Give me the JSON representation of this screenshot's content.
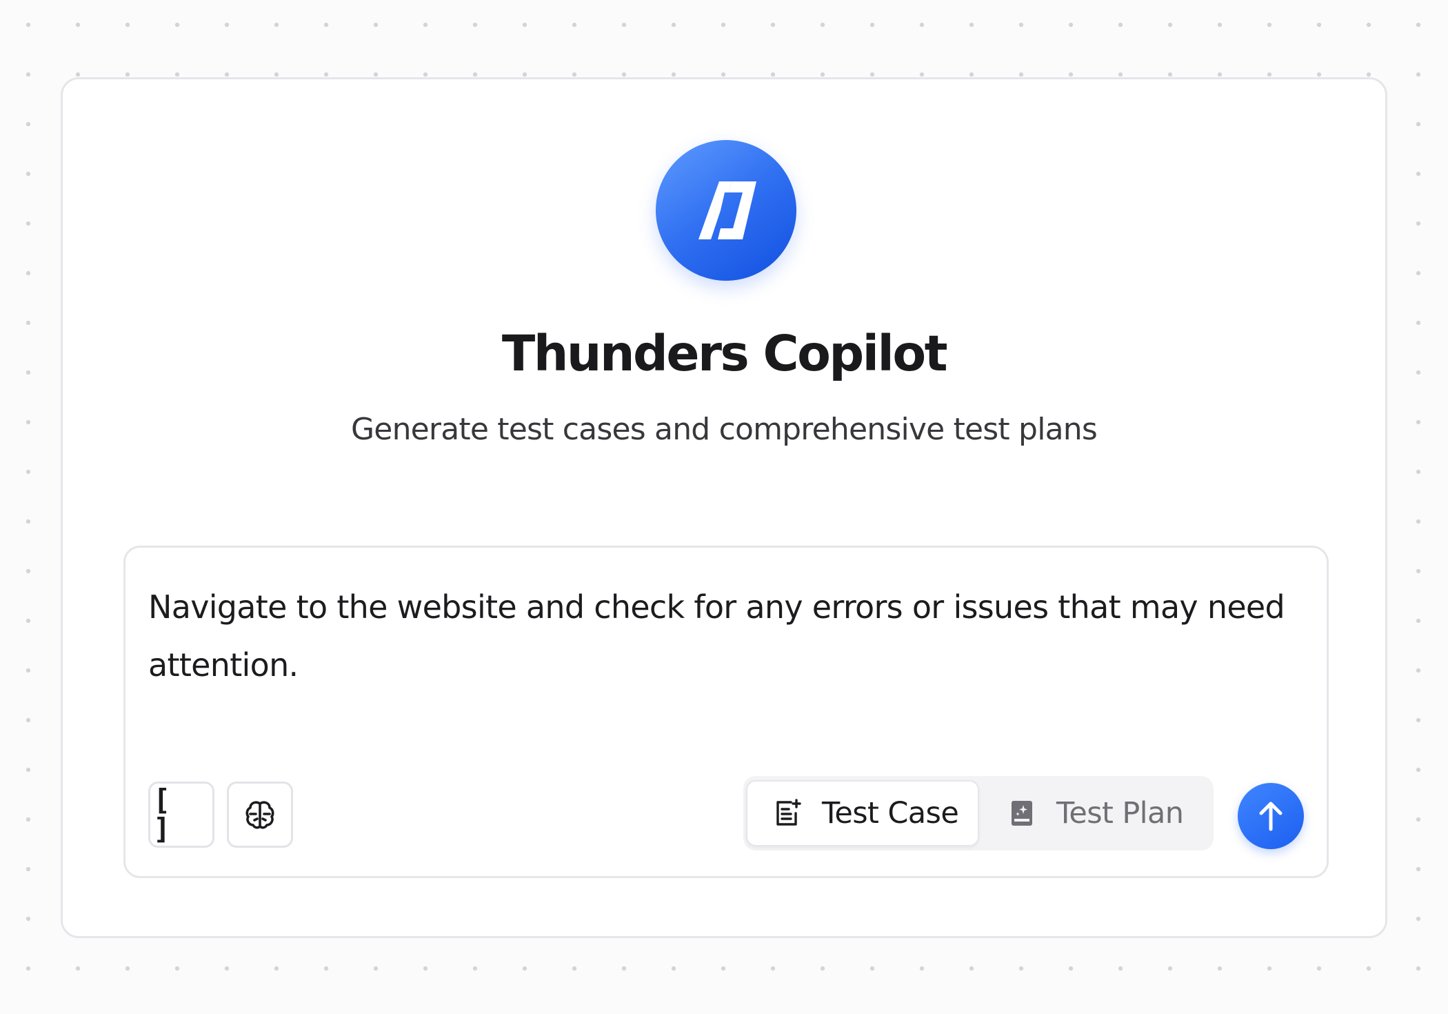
{
  "brand": {
    "logo_icon": "bolt-bracket-logo-icon",
    "accent_color": "#2a6cf3"
  },
  "hero": {
    "title": "Thunders Copilot",
    "subtitle": "Generate test cases and comprehensive test plans"
  },
  "composer": {
    "prompt_value": "Navigate to the website and check for any errors or issues that may need attention.",
    "tools": [
      {
        "label": "[ ]",
        "icon": "variables-brackets-icon"
      },
      {
        "icon": "brain-icon"
      }
    ],
    "modes": {
      "selected": "Test Case",
      "options": [
        {
          "label": "Test Case",
          "icon": "document-sparkle-icon"
        },
        {
          "label": "Test Plan",
          "icon": "notebook-sparkle-icon"
        }
      ]
    },
    "send_icon": "arrow-up-icon"
  }
}
